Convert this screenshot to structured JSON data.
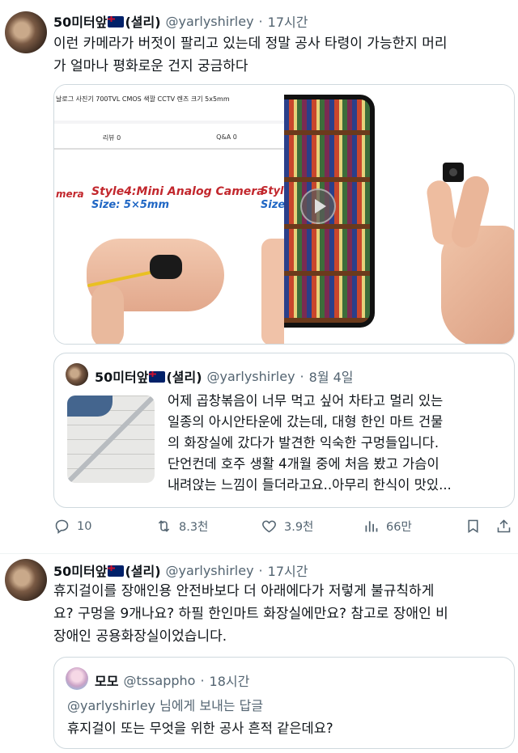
{
  "tweet1": {
    "name": "50미터앞",
    "suffix": "(셜리)",
    "handle": "@yarlyshirley",
    "dot": "·",
    "time": "17시간",
    "text_line1": "이런 카메라가 버젓이 팔리고 있는데 정말 공사 타령이 가능한지 머리",
    "text_line2": "가 얼마나 평화로운 건지 궁금하다",
    "media": {
      "ad_title": "날로그 사진기 700TVL CMOS 색깔 CCTV 렌즈 크기 5x5mm",
      "tab_reviews": "리뷰 0",
      "tab_qa": "Q&A 0",
      "cut_left": "mera",
      "style_label": "Style4:Mini Analog Camera",
      "size_label": "Size: 5×5mm",
      "cut_right": "Styl",
      "cut_right2": "Size"
    },
    "quote": {
      "name": "50미터앞",
      "suffix": "(셜리)",
      "handle": "@yarlyshirley",
      "dot": "·",
      "time": "8월 4일",
      "lines": [
        "어제 곱창볶음이 너무 먹고 싶어 차타고 멀리 있는",
        "일종의 아시안타운에 갔는데, 대형 한인 마트 건물",
        "의 화장실에 갔다가 발견한 익숙한 구멍들입니다.",
        "단언컨데 호주 생활 4개월 중에 처음 봤고 가슴이",
        "내려앉는 느낌이 들더라고요..아무리 한식이 맛있..."
      ]
    },
    "actions": {
      "replies": "10",
      "retweets": "8.3천",
      "likes": "3.9천",
      "views": "66만"
    }
  },
  "tweet2": {
    "name": "50미터앞",
    "suffix": "(셜리)",
    "handle": "@yarlyshirley",
    "dot": "·",
    "time": "17시간",
    "text_line1": "휴지걸이를 장애인용 안전바보다 더 아래에다가 저렇게 불규칙하게",
    "text_line2": "요? 구멍을 9개나요? 하필 한인마트 화장실에만요? 참고로 장애인 비",
    "text_line3": "장애인 공용화장실이었습니다.",
    "quote": {
      "name": "모모",
      "handle": "@tssappho",
      "dot": "·",
      "time": "18시간",
      "replying_handle": "@yarlyshirley",
      "replying_text": " 님에게 보내는 답글",
      "text": "휴지걸이 또는 무엇을 위한 공사 흔적 같은데요?"
    }
  },
  "colors": {
    "text": "#0f1419",
    "muted": "#536471",
    "border": "#cfd9de"
  },
  "icons": [
    "reply-icon",
    "retweet-icon",
    "like-icon",
    "views-icon",
    "bookmark-icon",
    "share-icon",
    "australia-flag-icon",
    "play-icon"
  ]
}
